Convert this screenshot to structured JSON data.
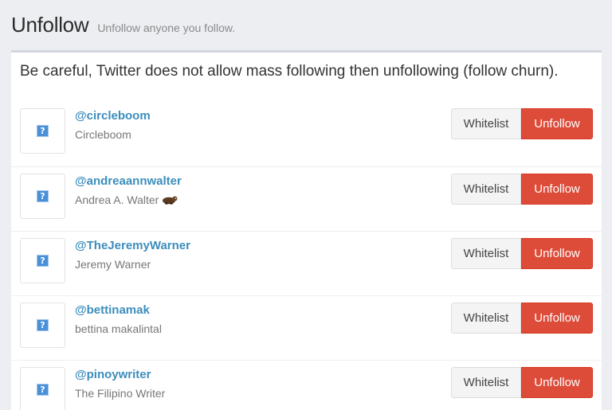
{
  "header": {
    "title": "Unfollow",
    "subtitle": "Unfollow anyone you follow."
  },
  "notice": "Be careful, Twitter does not allow mass following then unfollowing (follow churn).",
  "buttons": {
    "whitelist": "Whitelist",
    "unfollow": "Unfollow"
  },
  "colors": {
    "accent_link": "#3c8dbc",
    "unfollow_button": "#dd4b39",
    "avatar_placeholder": "#4a90d9"
  },
  "users": [
    {
      "handle": "@circleboom",
      "name": "Circleboom",
      "avatar_icon": "broken-image-icon"
    },
    {
      "handle": "@andreaannwalter",
      "name": "Andrea A. Walter",
      "emoji_icon": "otter-icon",
      "avatar_icon": "broken-image-icon"
    },
    {
      "handle": "@TheJeremyWarner",
      "name": "Jeremy Warner",
      "avatar_icon": "broken-image-icon"
    },
    {
      "handle": "@bettinamak",
      "name": "bettina makalintal",
      "avatar_icon": "broken-image-icon"
    },
    {
      "handle": "@pinoywriter",
      "name": "The Filipino Writer",
      "avatar_icon": "broken-image-icon"
    }
  ]
}
